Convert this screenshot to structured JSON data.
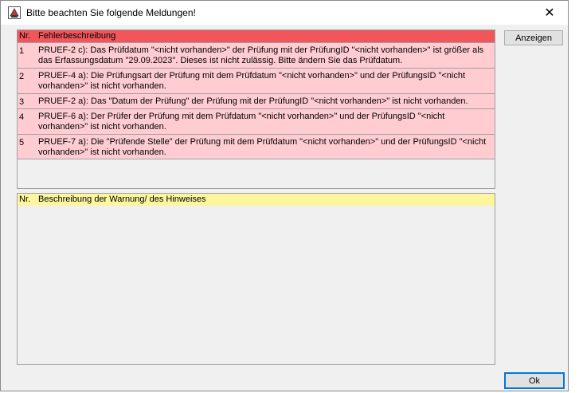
{
  "window": {
    "title": "Bitte beachten Sie folgende Meldungen!",
    "icon": "app-icon",
    "close_symbol": "✕"
  },
  "errors": {
    "header_nr": "Nr.",
    "header_desc": "Fehlerbeschreibung",
    "header_color": "#f0565b",
    "row_color": "#ffcdd1",
    "rows": [
      {
        "nr": "1",
        "text": "PRUEF-2 c): Das Prüfdatum \"<nicht vorhanden>\" der Prüfung mit der PrüfungID \"<nicht vorhanden>\" ist größer als das Erfassungsdatum \"29.09.2023\". Dieses ist nicht zulässig. Bitte ändern Sie das Prüfdatum."
      },
      {
        "nr": "2",
        "text": "PRUEF-4 a): Die Prüfungsart der Prüfung mit dem Prüfdatum \"<nicht vorhanden>\" und der PrüfungsID \"<nicht vorhanden>\" ist nicht vorhanden."
      },
      {
        "nr": "3",
        "text": "PRUEF-2 a): Das \"Datum der Prüfung\" der Prüfung mit der PrüfungID \"<nicht vorhanden>\" ist nicht vorhanden."
      },
      {
        "nr": "4",
        "text": "PRUEF-6 a): Der Prüfer der Prüfung mit dem Prüfdatum \"<nicht vorhanden>\" und der PrüfungsID \"<nicht vorhanden>\" ist nicht vorhanden."
      },
      {
        "nr": "5",
        "text": "PRUEF-7 a): Die \"Prüfende Stelle\" der Prüfung mit dem Prüfdatum \"<nicht vorhanden>\" und der PrüfungsID \"<nicht vorhanden>\" ist nicht vorhanden."
      }
    ]
  },
  "warnings": {
    "header_nr": "Nr.",
    "header_desc": "Beschreibung der Warnung/ des Hinweises",
    "header_color": "#fdf69e",
    "rows": []
  },
  "buttons": {
    "show_label": "Anzeigen",
    "ok_label": "Ok",
    "focus_color": "#0078d7"
  }
}
